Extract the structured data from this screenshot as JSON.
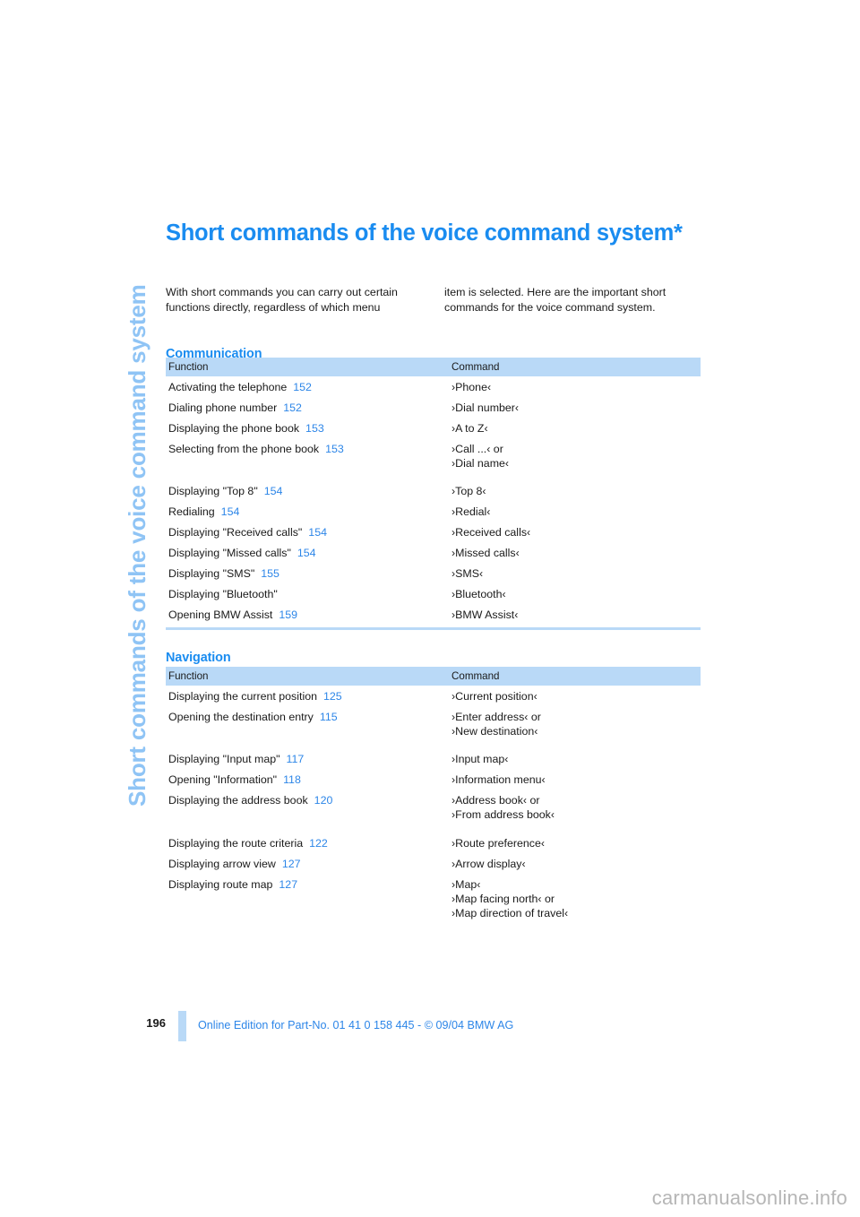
{
  "side_tab": {
    "label": "Short commands of the voice command system"
  },
  "page_title": "Short commands of the voice command system*",
  "intro": {
    "left": "With short commands you can carry out certain functions directly, regardless of which menu",
    "right": "item is selected. Here are the important short commands for the voice command system."
  },
  "sections": [
    {
      "heading": "Communication",
      "columns": {
        "function": "Function",
        "command": "Command"
      },
      "rows": [
        {
          "function": "Activating the telephone",
          "page": "152",
          "commands": [
            "›Phone‹"
          ]
        },
        {
          "function": "Dialing phone number",
          "page": "152",
          "commands": [
            "›Dial number‹"
          ]
        },
        {
          "function": "Displaying the phone book",
          "page": "153",
          "commands": [
            "›A to Z‹"
          ]
        },
        {
          "function": "Selecting from the phone book",
          "page": "153",
          "commands": [
            "›Call ...‹  or",
            "›Dial name‹"
          ],
          "spaced": true
        },
        {
          "function": "Displaying \"Top 8\"",
          "page": "154",
          "commands": [
            "›Top 8‹"
          ]
        },
        {
          "function": "Redialing",
          "page": "154",
          "commands": [
            "›Redial‹"
          ]
        },
        {
          "function": "Displaying \"Received calls\"",
          "page": "154",
          "commands": [
            "›Received calls‹"
          ]
        },
        {
          "function": "Displaying \"Missed calls\"",
          "page": "154",
          "commands": [
            "›Missed calls‹"
          ]
        },
        {
          "function": "Displaying \"SMS\"",
          "page": "155",
          "commands": [
            "›SMS‹"
          ]
        },
        {
          "function": "Displaying \"Bluetooth\"",
          "page": "",
          "commands": [
            "›Bluetooth‹"
          ]
        },
        {
          "function": "Opening BMW Assist",
          "page": "159",
          "commands": [
            "›BMW Assist‹"
          ]
        }
      ]
    },
    {
      "heading": "Navigation",
      "columns": {
        "function": "Function",
        "command": "Command"
      },
      "rows": [
        {
          "function": "Displaying the current position",
          "page": "125",
          "commands": [
            "›Current position‹"
          ]
        },
        {
          "function": "Opening the destination entry",
          "page": "115",
          "commands": [
            "›Enter address‹  or",
            "›New destination‹"
          ],
          "spaced": true
        },
        {
          "function": "Displaying \"Input map\"",
          "page": "117",
          "commands": [
            "›Input map‹"
          ]
        },
        {
          "function": "Opening \"Information\"",
          "page": "118",
          "commands": [
            "›Information menu‹"
          ]
        },
        {
          "function": "Displaying the address book",
          "page": "120",
          "commands": [
            "›Address book‹  or",
            "›From address book‹"
          ],
          "spaced": true
        },
        {
          "function": "Displaying the route criteria",
          "page": "122",
          "commands": [
            "›Route preference‹"
          ]
        },
        {
          "function": "Displaying arrow view",
          "page": "127",
          "commands": [
            "›Arrow display‹"
          ]
        },
        {
          "function": "Displaying route map",
          "page": "127",
          "commands": [
            "›Map‹",
            "›Map facing north‹  or",
            "›Map direction of travel‹"
          ]
        }
      ]
    }
  ],
  "footer": {
    "folio": "196",
    "text": "Online Edition for Part-No. 01 41 0 158 445 - © 09/04 BMW AG"
  },
  "watermark": "carmanualsonline.info",
  "colors": {
    "accent_blue": "#1a8cf0",
    "light_blue": "#b9d9f7",
    "side_tab_blue": "#8fc4f5",
    "page_ref_blue": "#2d86e8"
  }
}
